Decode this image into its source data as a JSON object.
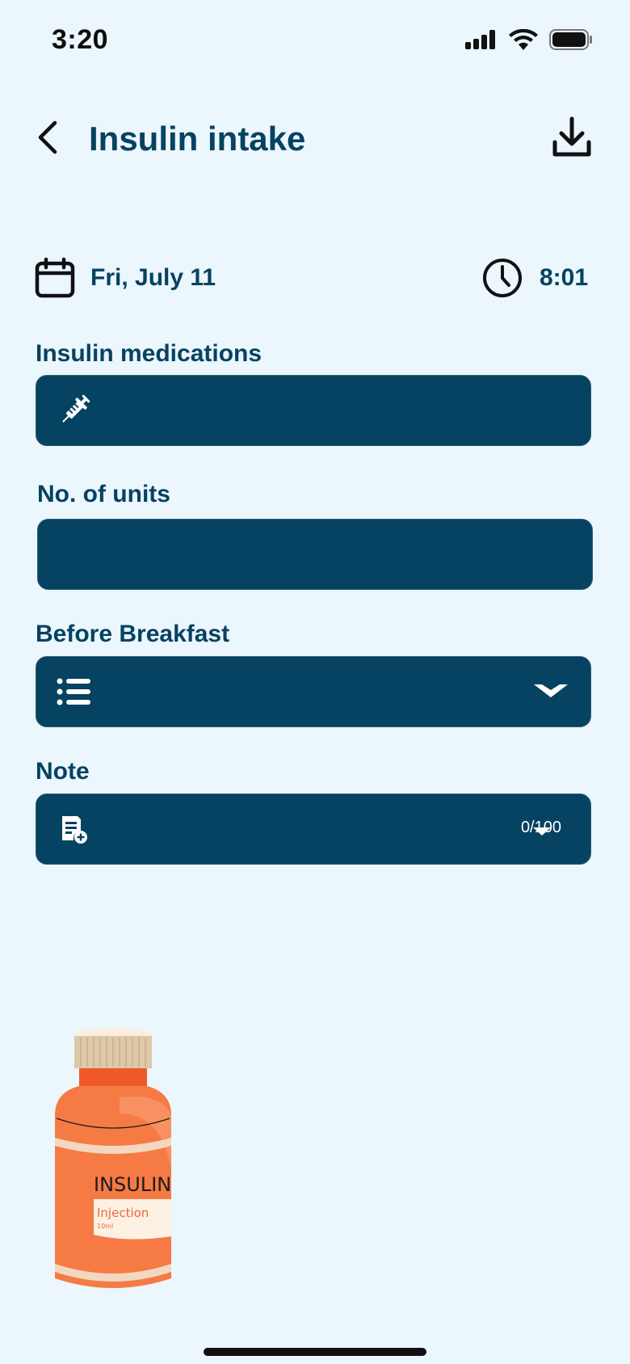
{
  "status_bar": {
    "time": "3:20"
  },
  "header": {
    "title": "Insulin intake"
  },
  "datetime": {
    "date": "Fri, July 11",
    "time": "8:01"
  },
  "fields": {
    "medications": {
      "label": "Insulin medications",
      "value": ""
    },
    "units": {
      "label": "No. of units",
      "value": ""
    },
    "meal_time": {
      "label": "Before Breakfast",
      "value": ""
    },
    "note": {
      "label": "Note",
      "value": "",
      "counter": "0/100"
    }
  },
  "illustration": {
    "brand": "INSULIN",
    "type": "Injection",
    "volume": "10ml"
  },
  "colors": {
    "background": "#ebf6fd",
    "primary": "#064261",
    "accent": "#f47b45"
  }
}
